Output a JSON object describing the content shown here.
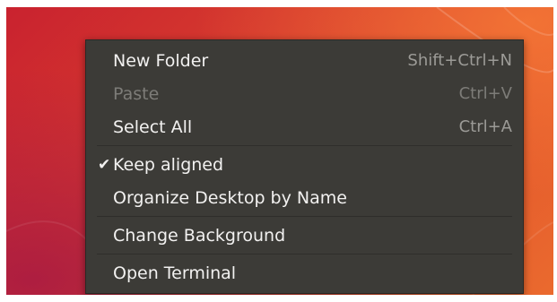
{
  "menu": {
    "items": [
      {
        "label": "New Folder",
        "shortcut": "Shift+Ctrl+N"
      },
      {
        "label": "Paste",
        "shortcut": "Ctrl+V",
        "disabled": true
      },
      {
        "label": "Select All",
        "shortcut": "Ctrl+A"
      },
      {
        "label": "Keep aligned",
        "checked": true,
        "check_glyph": "✔"
      },
      {
        "label": "Organize Desktop by Name"
      },
      {
        "label": "Change Background"
      },
      {
        "label": "Open Terminal"
      }
    ]
  },
  "colors": {
    "menu_bg": "#3c3b37",
    "text": "#f2f1f0",
    "disabled_text": "#7d7c78",
    "wallpaper_red": "#d63a2e",
    "wallpaper_orange": "#ea6a2e"
  },
  "icons": [
    "checkmark-icon"
  ]
}
